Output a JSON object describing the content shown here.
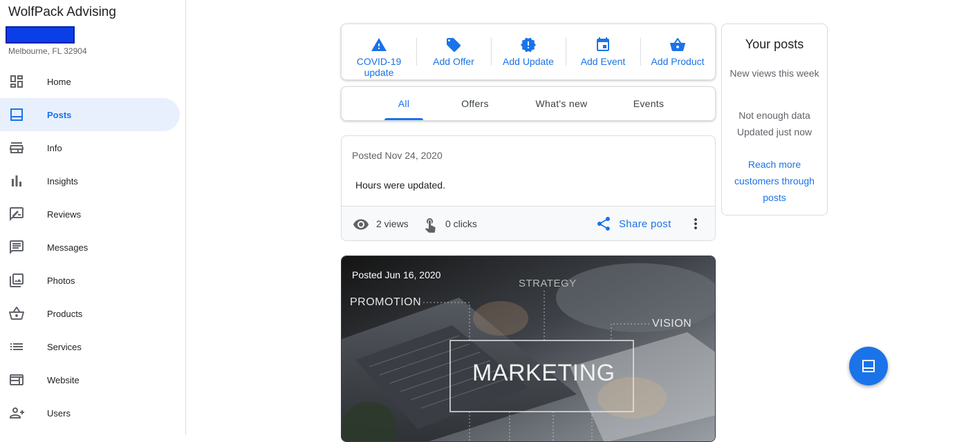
{
  "business": {
    "name": "WolfPack Advising",
    "address": "Melbourne, FL 32904"
  },
  "sidebar": {
    "items": [
      {
        "label": "Home",
        "icon": "dashboard-icon"
      },
      {
        "label": "Posts",
        "icon": "posts-icon",
        "active": true
      },
      {
        "label": "Info",
        "icon": "storefront-icon"
      },
      {
        "label": "Insights",
        "icon": "bar-chart-icon"
      },
      {
        "label": "Reviews",
        "icon": "rate-review-icon"
      },
      {
        "label": "Messages",
        "icon": "message-icon"
      },
      {
        "label": "Photos",
        "icon": "photo-library-icon"
      },
      {
        "label": "Products",
        "icon": "basket-icon"
      },
      {
        "label": "Services",
        "icon": "list-icon"
      },
      {
        "label": "Website",
        "icon": "web-icon"
      },
      {
        "label": "Users",
        "icon": "person-add-icon"
      }
    ]
  },
  "actions": [
    {
      "label": "COVID-19 update",
      "icon": "warning-icon"
    },
    {
      "label": "Add Offer",
      "icon": "tag-icon"
    },
    {
      "label": "Add Update",
      "icon": "new-release-icon"
    },
    {
      "label": "Add Event",
      "icon": "calendar-icon"
    },
    {
      "label": "Add Product",
      "icon": "basket-icon"
    }
  ],
  "tabs": [
    {
      "label": "All",
      "active": true
    },
    {
      "label": "Offers"
    },
    {
      "label": "What's new"
    },
    {
      "label": "Events"
    }
  ],
  "posts": [
    {
      "date": "Posted Nov 24, 2020",
      "text": "Hours were updated.",
      "views": "2 views",
      "clicks": "0 clicks",
      "share_label": "Share post"
    },
    {
      "date": "Posted Jun 16, 2020",
      "image_words": {
        "promotion": "PROMOTION",
        "strategy": "STRATEGY",
        "vision": "VISION",
        "marketing": "MARKETING"
      }
    }
  ],
  "your_posts": {
    "title": "Your posts",
    "subtitle": "New views this week",
    "no_data": "Not enough data",
    "updated": "Updated just now",
    "link": "Reach more customers through posts"
  },
  "colors": {
    "accent": "#1a73e8",
    "active_bg": "#e8f0fe",
    "redaction": "#0a3ee6"
  }
}
